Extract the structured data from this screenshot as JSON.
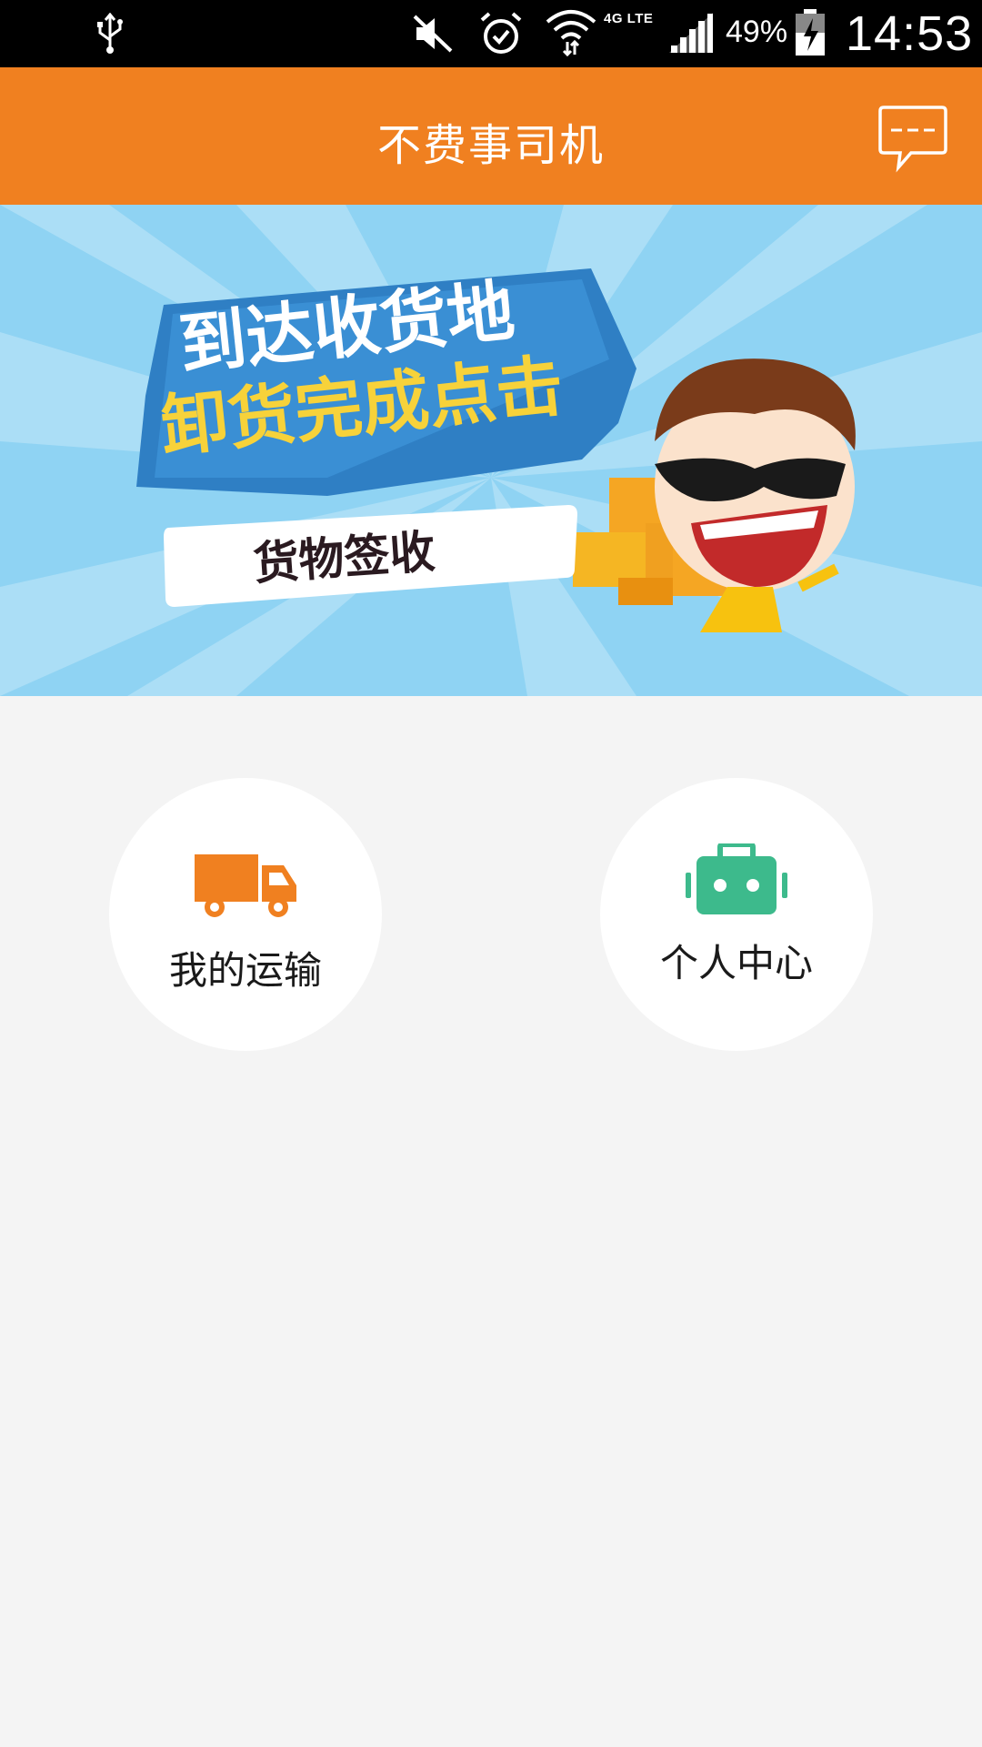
{
  "status_bar": {
    "network": "4G LTE",
    "battery": "49%",
    "time": "14:53",
    "icons": [
      "usb-icon",
      "mute-icon",
      "alarm-icon",
      "wifi-icon",
      "signal-icon",
      "battery-icon"
    ]
  },
  "header": {
    "title": "不费事司机",
    "message_icon": "chat-bubble-icon"
  },
  "banner": {
    "line1": "到达收货地",
    "line2": "卸货完成点击",
    "button": "货物签收"
  },
  "menu": {
    "items": [
      {
        "label": "我的运输",
        "icon": "truck-icon",
        "color": "#f08020"
      },
      {
        "label": "个人中心",
        "icon": "briefcase-icon",
        "color": "#3dba8c"
      }
    ]
  },
  "colors": {
    "accent": "#f08020",
    "banner_bg": "#8fd3f3",
    "page_bg": "#f4f4f4"
  }
}
